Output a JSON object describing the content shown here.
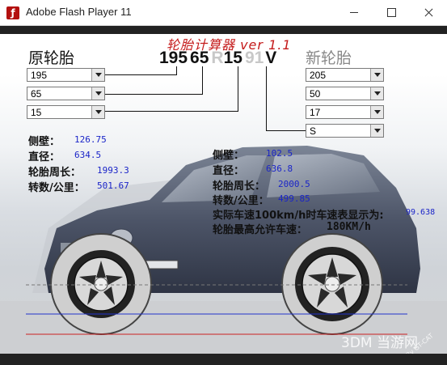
{
  "window": {
    "title": "Adobe Flash Player 11",
    "icon": "flash-player-icon"
  },
  "app": {
    "title": "轮胎计算器 ver 1.1"
  },
  "original": {
    "label": "原轮胎",
    "width": "195",
    "aspect": "65",
    "rim": "15",
    "stats": {
      "sidewall_label": "侧壁：",
      "sidewall_value": "126.75",
      "diameter_label": "直径：",
      "diameter_value": "634.5",
      "circumference_label": "轮胎周长：",
      "circumference_value": "1993.3",
      "revs_label": "转数/公里：",
      "revs_value": "501.67"
    }
  },
  "new_tire": {
    "label": "新轮胎",
    "width": "205",
    "aspect": "50",
    "rim": "17",
    "speed_rating": "S",
    "stats": {
      "sidewall_label": "侧壁：",
      "sidewall_value": "102.5",
      "diameter_label": "直径：",
      "diameter_value": "636.8",
      "circumference_label": "轮胎周长：",
      "circumference_value": "2000.5",
      "revs_label": "转数/公里：",
      "revs_value": "499.85",
      "actual_speed_label": "实际车速100km/h时车速表显示为:",
      "actual_speed_value": "99.638",
      "max_speed_label": "轮胎最高允许车速：",
      "max_speed_value": "180KM/h"
    }
  },
  "tire_code": {
    "width": "195",
    "aspect": "65",
    "r": "R",
    "rim": "15",
    "load": "91",
    "speed": "V"
  },
  "watermark": {
    "text": "3DM 当游网",
    "credit": "By GT-CAT"
  },
  "colors": {
    "title_red": "#c41a1a",
    "value_blue": "#1a24c8",
    "blue_line": "#2233cc",
    "red_line": "#cc2222"
  }
}
